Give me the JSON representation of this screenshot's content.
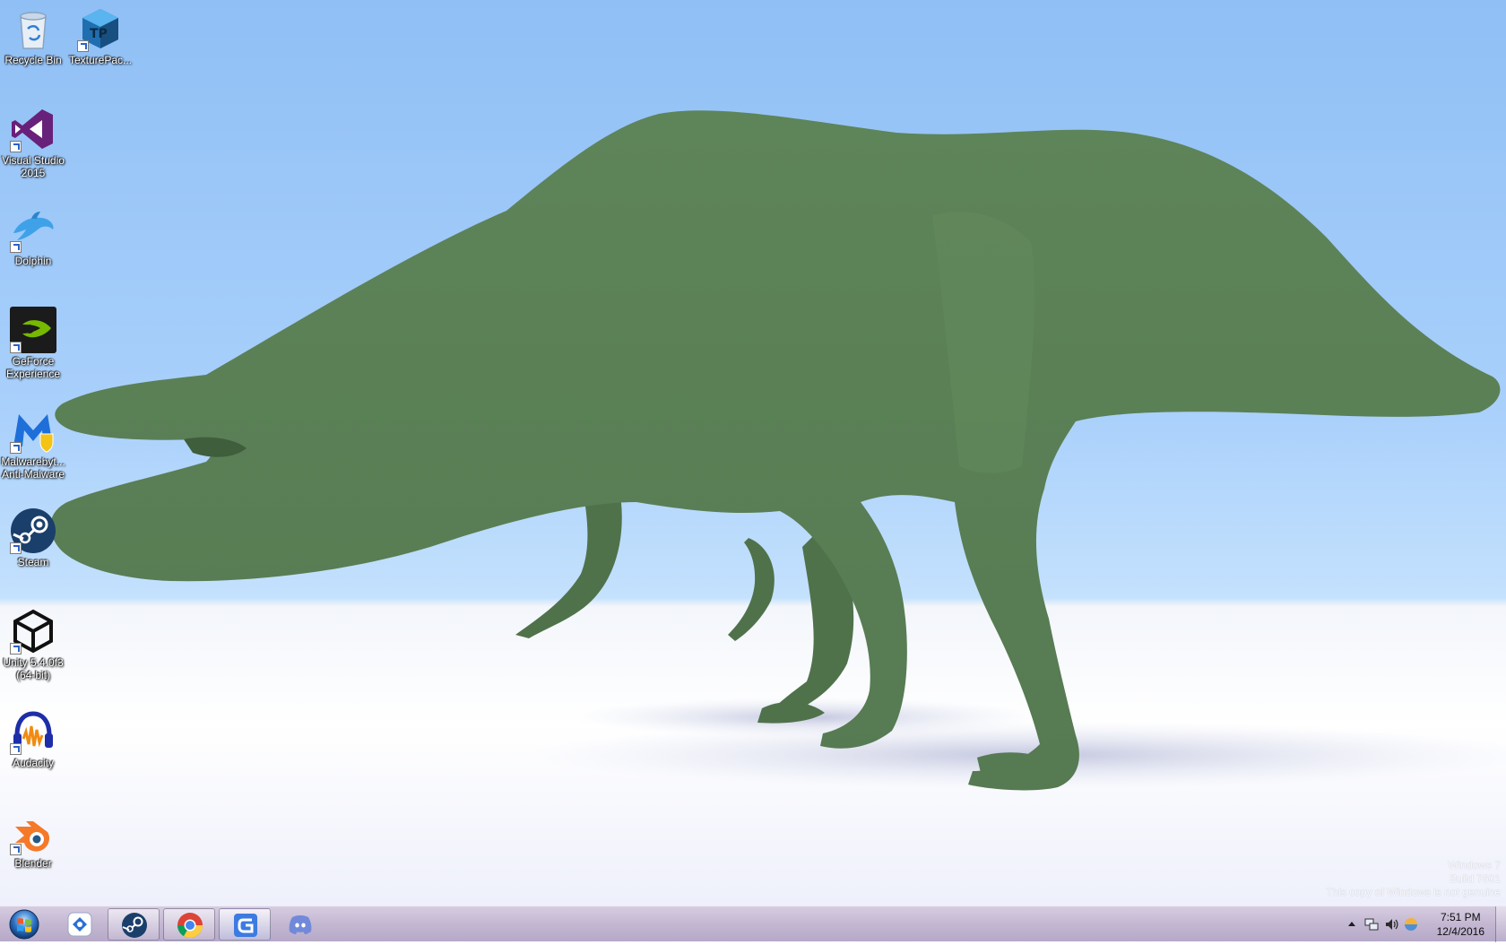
{
  "desktop": {
    "icons": [
      {
        "label": "Recycle Bin",
        "icon": "recycle-bin-icon"
      },
      {
        "label": "TexturePac...",
        "icon": "texturepacker-icon"
      },
      {
        "label": "Visual Studio 2015",
        "icon": "visual-studio-icon"
      },
      {
        "label": "Dolphin",
        "icon": "dolphin-icon"
      },
      {
        "label": "GeForce Experience",
        "icon": "geforce-icon"
      },
      {
        "label": "Malwarebyt... Anti-Malware",
        "icon": "malwarebytes-icon"
      },
      {
        "label": "Steam",
        "icon": "steam-icon"
      },
      {
        "label": "Unity 5.4.0f3 (64-bit)",
        "icon": "unity-icon"
      },
      {
        "label": "Audacity",
        "icon": "audacity-icon"
      },
      {
        "label": "Blender",
        "icon": "blender-icon"
      }
    ],
    "watermark": {
      "line1": "Windows 7",
      "line2": "Build 7601",
      "line3": "This copy of Windows is not genuine"
    },
    "colors": {
      "dinosaur": "#5b7f58",
      "sky": "#9ccaf8",
      "ground": "#f4f6fb"
    }
  },
  "taskbar": {
    "pinned": [
      {
        "icon": "start-orb-icon"
      },
      {
        "icon": "remote-desktop-icon"
      },
      {
        "icon": "steam-icon"
      },
      {
        "icon": "chrome-icon"
      },
      {
        "icon": "gamemaker-icon",
        "active": true
      },
      {
        "icon": "discord-icon"
      }
    ],
    "tray": {
      "icons": [
        "show-hidden-icons-icon",
        "network-icon",
        "volume-icon",
        "flag-icon"
      ]
    },
    "clock": {
      "time": "7:51 PM",
      "date": "12/4/2016"
    }
  }
}
